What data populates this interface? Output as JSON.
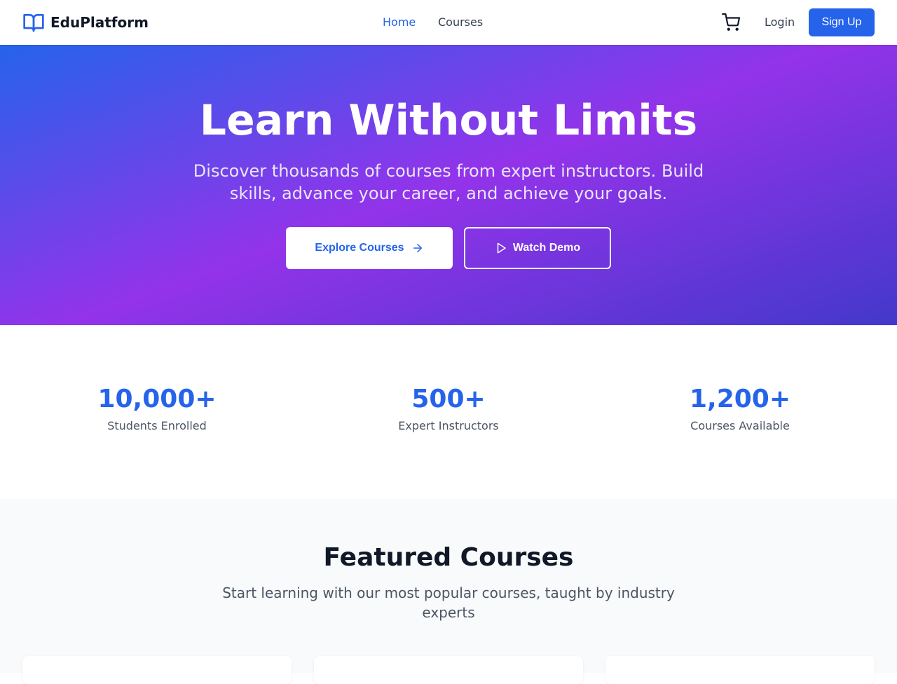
{
  "header": {
    "brand": "EduPlatform",
    "nav": [
      {
        "label": "Home",
        "active": true
      },
      {
        "label": "Courses",
        "active": false
      }
    ],
    "login_label": "Login",
    "signup_label": "Sign Up",
    "cart_icon": "shopping-cart-icon",
    "logo_icon": "open-book-icon"
  },
  "hero": {
    "title": "Learn Without Limits",
    "subtitle": "Discover thousands of courses from expert instructors. Build skills, advance your career, and achieve your goals.",
    "primary_button": "Explore Courses",
    "secondary_button": "Watch Demo",
    "gradient_colors": [
      "#2563eb",
      "#9333ea",
      "#4338ca"
    ]
  },
  "stats": [
    {
      "value": "10,000+",
      "label": "Students Enrolled"
    },
    {
      "value": "500+",
      "label": "Expert Instructors"
    },
    {
      "value": "1,200+",
      "label": "Courses Available"
    }
  ],
  "featured": {
    "title": "Featured Courses",
    "subtitle": "Start learning with our most popular courses, taught by industry experts"
  },
  "colors": {
    "accent": "#2563eb",
    "text": "#111827",
    "muted": "#4b5563"
  }
}
